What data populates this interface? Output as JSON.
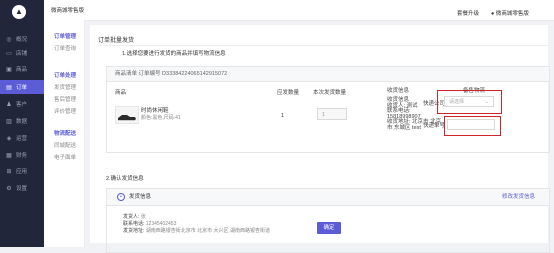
{
  "topbar": {
    "shop_name": "微商城零售版",
    "upgrade": "套餐升级",
    "store": "● 微商城零售版"
  },
  "sidebar": {
    "avatar_glyph": "▲",
    "items": [
      {
        "label": "概况",
        "icon": "◎"
      },
      {
        "label": "店铺",
        "icon": "▭"
      },
      {
        "label": "商品",
        "icon": "▣"
      },
      {
        "label": "订单",
        "icon": "▤"
      },
      {
        "label": "客户",
        "icon": "♟"
      },
      {
        "label": "数据",
        "icon": "▥"
      },
      {
        "label": "运营",
        "icon": "◈"
      },
      {
        "label": "财务",
        "icon": "▦"
      },
      {
        "label": "应用",
        "icon": "⊞"
      },
      {
        "label": "设置",
        "icon": "⚙"
      }
    ]
  },
  "subnav": {
    "groups": [
      {
        "title": "订单管理",
        "items": [
          "订单查询"
        ]
      },
      {
        "title": "订单处理",
        "items": [
          "发货管理",
          "售后管理",
          "评价管理"
        ]
      },
      {
        "title": "物流配送",
        "items": [
          "同城配送",
          "电子面单"
        ]
      }
    ]
  },
  "main": {
    "title": "订单批量发货",
    "step1": "1.选择您要进行发货的商品并填写物流信息",
    "order_header": "商品清单 订单编号 D33384224065142915072",
    "columns": {
      "product": "商品",
      "qty": "应发数量",
      "send_qty": "本次发货数量",
      "receiver": "收货信息",
      "logistics": "备售物流"
    },
    "product": {
      "name": "时尚休闲鞋",
      "spec": "颜色:黑色,尺码:41",
      "qty": "1",
      "send_qty": "1"
    },
    "receiver_lines": [
      "收货信息",
      "收货人: 测试",
      "联系电话:",
      "15818998907",
      "收货地址: 北京市 北京",
      "市 东城区 test"
    ],
    "company_label": "快递公司",
    "company_placeholder": "请选择",
    "tracking_label": "快递单号",
    "step2": "2.确认发货信息",
    "shipping_info": {
      "title": "发货信息",
      "edit": "修改发货信息",
      "sender_label": "发货人:",
      "sender_value": "张",
      "phone_label": "联系电话:",
      "phone_value": "12345402453",
      "address_label": "发货地址:",
      "address_value": "湖南西路银杏街北京市 北京市 大兴区 湖南西路银杏街道"
    },
    "confirm": "确定"
  },
  "colors": {
    "sidebar_bg": "#22263a",
    "accent": "#5c5cd6",
    "highlight": "#d0242b"
  }
}
